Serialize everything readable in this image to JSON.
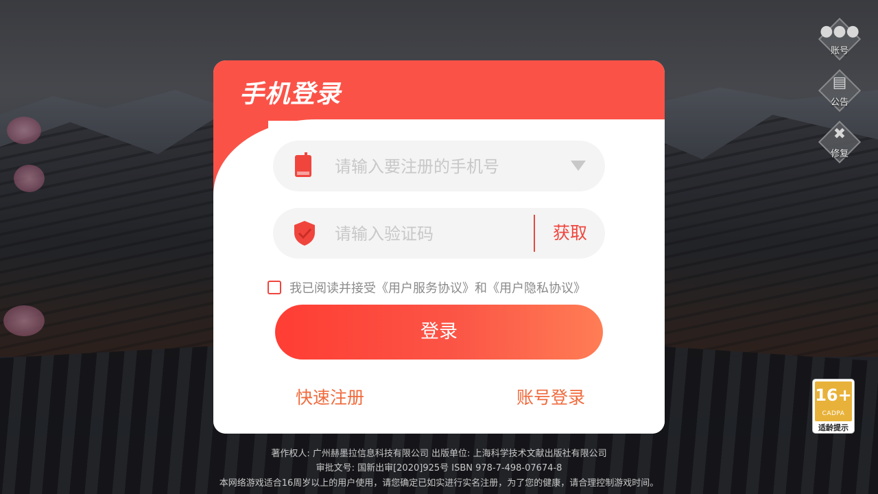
{
  "side_buttons": [
    {
      "label": "账号",
      "icon": "group-icon"
    },
    {
      "label": "公告",
      "icon": "notice-icon"
    },
    {
      "label": "修复",
      "icon": "wrench-icon"
    }
  ],
  "dialog": {
    "title": "手机登录",
    "phone_placeholder": "请输入要注册的手机号",
    "code_placeholder": "请输入验证码",
    "get_code_label": "获取",
    "agreement_text": "我已阅读并接受《用户服务协议》和《用户隐私协议》",
    "agreement_checked": false,
    "login_label": "登录",
    "quick_register_label": "快速注册",
    "account_login_label": "账号登录"
  },
  "age_rating": {
    "number": "16+",
    "org": "CADPA",
    "tip": "适龄提示"
  },
  "footer": {
    "line1": "著作权人: 广州赫墨拉信息科技有限公司 出版单位: 上海科学技术文献出版社有限公司",
    "line2": "审批文号: 国新出审[2020]925号  ISBN 978-7-498-07674-8",
    "line3": "本网络游戏适合16周岁以上的用户使用，请您确定已如实进行实名注册，为了您的健康，请合理控制游戏时间。"
  },
  "colors": {
    "accent": "#fb5248",
    "link": "#f06a3c",
    "badge": "#e8b23a"
  }
}
